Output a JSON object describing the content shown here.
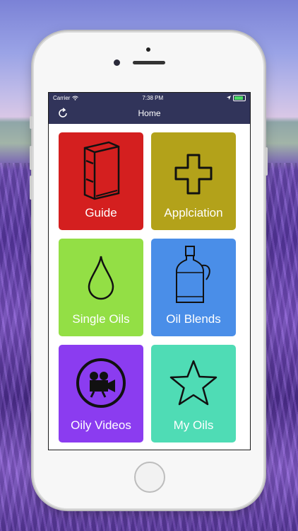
{
  "status": {
    "carrier": "Carrier",
    "time": "7:38 PM"
  },
  "nav": {
    "title": "Home"
  },
  "tiles": [
    {
      "label": "Guide",
      "color": "#d41f1f",
      "icon": "book-icon"
    },
    {
      "label": "Applciation",
      "color": "#b3a21a",
      "icon": "cross-icon"
    },
    {
      "label": "Single Oils",
      "color": "#93df45",
      "icon": "drop-icon"
    },
    {
      "label": "Oil Blends",
      "color": "#4a8ee8",
      "icon": "bottle-icon"
    },
    {
      "label": "Oily Videos",
      "color": "#8b3cf0",
      "icon": "video-camera-icon"
    },
    {
      "label": "My Oils",
      "color": "#4fdcb5",
      "icon": "star-icon"
    }
  ]
}
